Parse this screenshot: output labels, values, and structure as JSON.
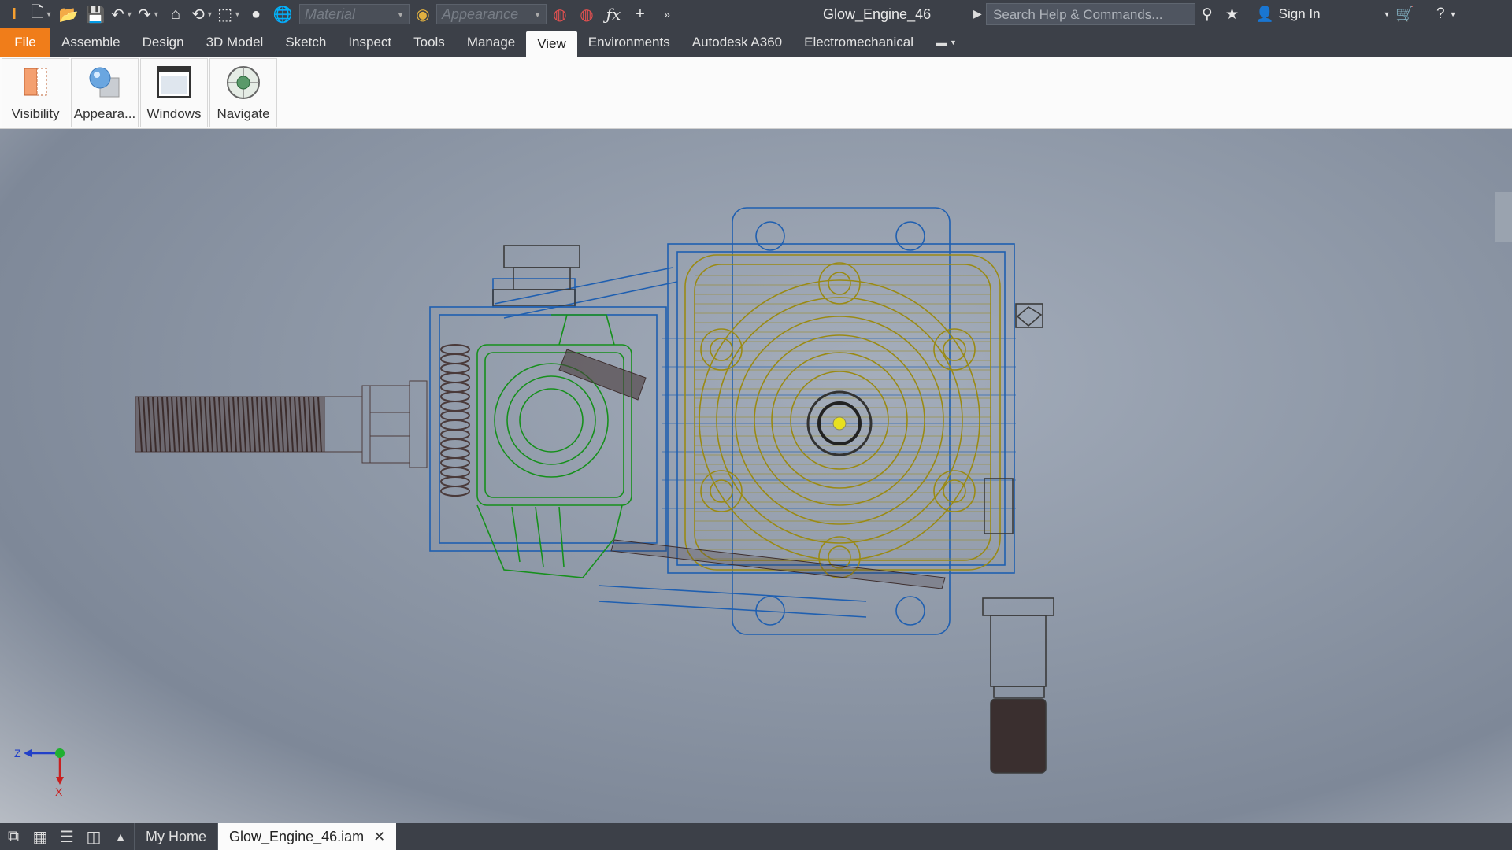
{
  "qat": {
    "material_placeholder": "Material",
    "appearance_placeholder": "Appearance",
    "document_title": "Glow_Engine_46",
    "search_placeholder": "Search Help & Commands...",
    "sign_in_label": "Sign In"
  },
  "tabs": {
    "file": "File",
    "items": [
      "Assemble",
      "Design",
      "3D Model",
      "Sketch",
      "Inspect",
      "Tools",
      "Manage",
      "View",
      "Environments",
      "Autodesk A360",
      "Electromechanical"
    ],
    "active": "View"
  },
  "ribbon": {
    "buttons": [
      {
        "label": "Visibility",
        "icon": "visibility-icon"
      },
      {
        "label": "Appeara...",
        "icon": "appearance-icon"
      },
      {
        "label": "Windows",
        "icon": "windows-icon"
      },
      {
        "label": "Navigate",
        "icon": "navigate-icon"
      }
    ]
  },
  "viewport": {
    "triad": {
      "z_label": "Z",
      "x_label": "X"
    }
  },
  "bottom": {
    "home_tab": "My Home",
    "doc_tab": "Glow_Engine_46.iam"
  },
  "colors": {
    "accent_file": "#f07d1a",
    "chrome": "#3c4048",
    "wire_blue": "#1f5fb0",
    "wire_gold": "#9a8a14",
    "wire_green": "#16901c",
    "wire_dark": "#4a3a3a"
  }
}
